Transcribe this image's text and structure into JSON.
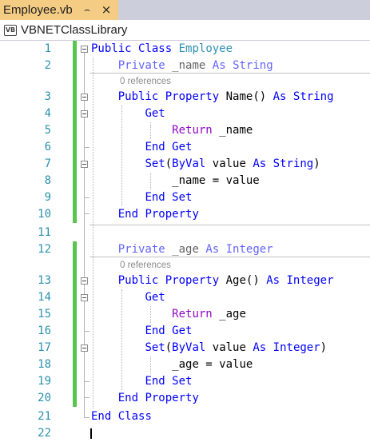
{
  "tab": {
    "title": "Employee.vb",
    "pin_glyph": "⌢",
    "close_glyph": "×",
    "bg_color": "#f5cc84"
  },
  "navbar": {
    "project_icon_label": "VB",
    "project_name": "VBNETClassLibrary"
  },
  "editor": {
    "line_numbers": [
      "1",
      "2",
      "3",
      "4",
      "5",
      "6",
      "7",
      "8",
      "9",
      "10",
      "11",
      "12",
      "13",
      "14",
      "15",
      "16",
      "17",
      "18",
      "19",
      "20",
      "21",
      "22"
    ],
    "code_lens": {
      "name_field_references": "0 references",
      "age_field_references": "0 references"
    },
    "code": {
      "l1": {
        "kw1": "Public",
        "kw2": "Class",
        "type": "Employee"
      },
      "l2": {
        "kw1": "Private",
        "ident": "_name",
        "kw2": "As",
        "kw3": "String"
      },
      "l3": {
        "kw1": "Public",
        "kw2": "Property",
        "ident": "Name()",
        "kw3": "As",
        "kw4": "String"
      },
      "l4": {
        "kw": "Get"
      },
      "l5": {
        "kw": "Return",
        "ident": "_name"
      },
      "l6": {
        "kw1": "End",
        "kw2": "Get"
      },
      "l7": {
        "kw1": "Set",
        "p1": "(",
        "kw2": "ByVal",
        "ident": "value",
        "kw3": "As",
        "kw4": "String",
        "p2": ")"
      },
      "l8": {
        "text": "_name = value"
      },
      "l9": {
        "kw1": "End",
        "kw2": "Set"
      },
      "l10": {
        "kw1": "End",
        "kw2": "Property"
      },
      "l12": {
        "kw1": "Private",
        "ident": "_age",
        "kw2": "As",
        "kw3": "Integer"
      },
      "l13": {
        "kw1": "Public",
        "kw2": "Property",
        "ident": "Age()",
        "kw3": "As",
        "kw4": "Integer"
      },
      "l14": {
        "kw": "Get"
      },
      "l15": {
        "kw": "Return",
        "ident": "_age"
      },
      "l16": {
        "kw1": "End",
        "kw2": "Get"
      },
      "l17": {
        "kw1": "Set",
        "p1": "(",
        "kw2": "ByVal",
        "ident": "value",
        "kw3": "As",
        "kw4": "Integer",
        "p2": ")"
      },
      "l18": {
        "text": "_age = value"
      },
      "l19": {
        "kw1": "End",
        "kw2": "Set"
      },
      "l20": {
        "kw1": "End",
        "kw2": "Property"
      },
      "l21": {
        "kw1": "End",
        "kw2": "Class"
      }
    },
    "colors": {
      "keyword": "#0000ff",
      "control_keyword": "#8f08c4",
      "type": "#2b91af",
      "line_number": "#2b91af",
      "changed_bar": "#57c54e"
    },
    "icons": [
      "outline-collapse-icon",
      "changed-lines-bar"
    ]
  }
}
